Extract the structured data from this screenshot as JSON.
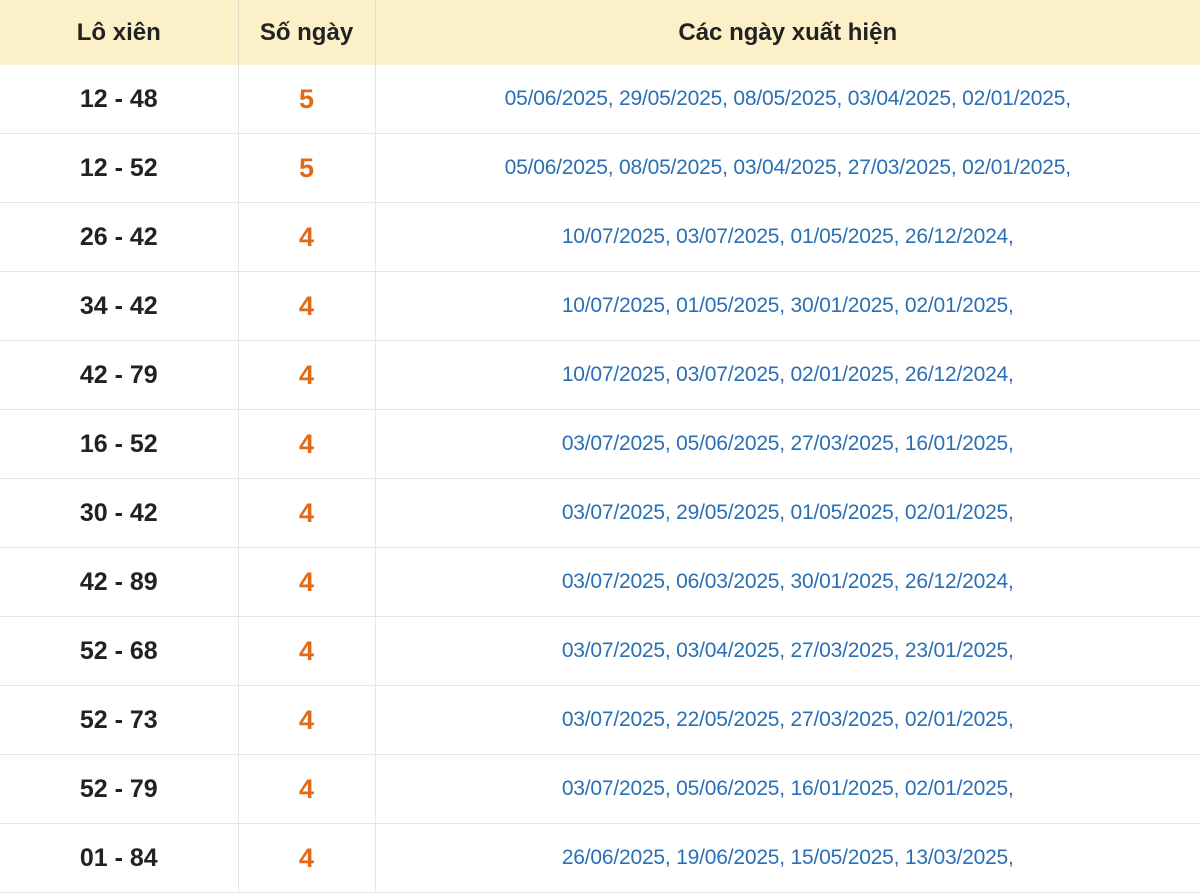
{
  "header": {
    "col_pair": "Lô xiên",
    "col_count": "Số ngày",
    "col_dates": "Các ngày xuất hiện"
  },
  "rows": [
    {
      "pair": "12 - 48",
      "count": "5",
      "dates": "05/06/2025, 29/05/2025, 08/05/2025, 03/04/2025, 02/01/2025,"
    },
    {
      "pair": "12 - 52",
      "count": "5",
      "dates": "05/06/2025, 08/05/2025, 03/04/2025, 27/03/2025, 02/01/2025,"
    },
    {
      "pair": "26 - 42",
      "count": "4",
      "dates": "10/07/2025, 03/07/2025, 01/05/2025, 26/12/2024,"
    },
    {
      "pair": "34 - 42",
      "count": "4",
      "dates": "10/07/2025, 01/05/2025, 30/01/2025, 02/01/2025,"
    },
    {
      "pair": "42 - 79",
      "count": "4",
      "dates": "10/07/2025, 03/07/2025, 02/01/2025, 26/12/2024,"
    },
    {
      "pair": "16 - 52",
      "count": "4",
      "dates": "03/07/2025, 05/06/2025, 27/03/2025, 16/01/2025,"
    },
    {
      "pair": "30 - 42",
      "count": "4",
      "dates": "03/07/2025, 29/05/2025, 01/05/2025, 02/01/2025,"
    },
    {
      "pair": "42 - 89",
      "count": "4",
      "dates": "03/07/2025, 06/03/2025, 30/01/2025, 26/12/2024,"
    },
    {
      "pair": "52 - 68",
      "count": "4",
      "dates": "03/07/2025, 03/04/2025, 27/03/2025, 23/01/2025,"
    },
    {
      "pair": "52 - 73",
      "count": "4",
      "dates": "03/07/2025, 22/05/2025, 27/03/2025, 02/01/2025,"
    },
    {
      "pair": "52 - 79",
      "count": "4",
      "dates": "03/07/2025, 05/06/2025, 16/01/2025, 02/01/2025,"
    },
    {
      "pair": "01 - 84",
      "count": "4",
      "dates": "26/06/2025, 19/06/2025, 15/05/2025, 13/03/2025,"
    }
  ],
  "colors": {
    "header_bg": "#fcf0c8",
    "count_color": "#e06a16",
    "dates_color": "#2a6fb5"
  }
}
